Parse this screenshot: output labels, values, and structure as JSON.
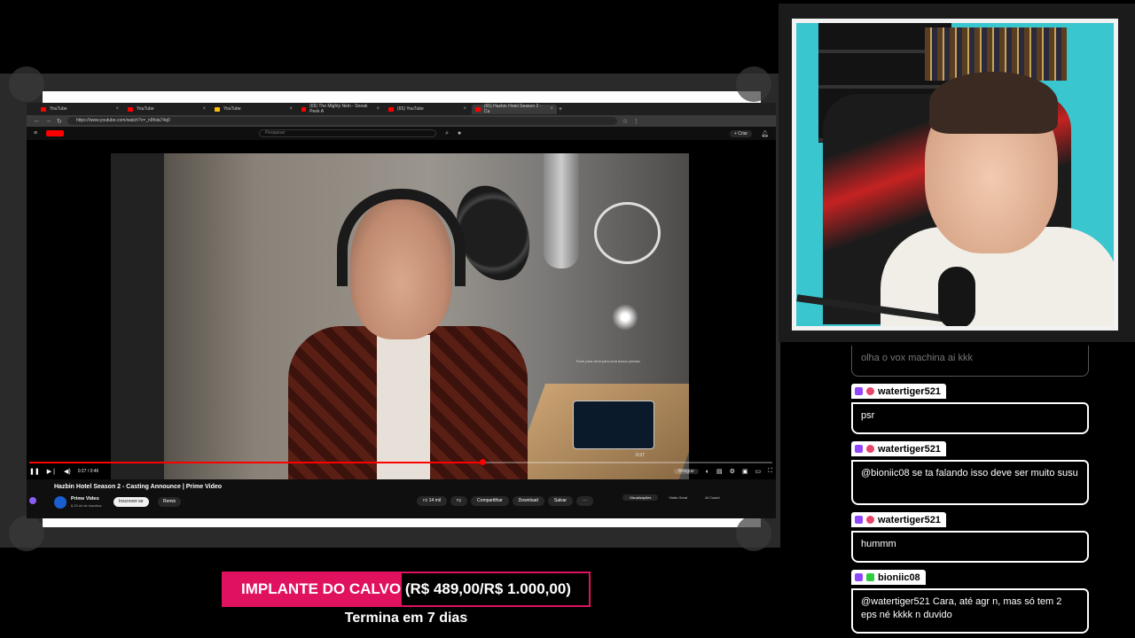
{
  "browser": {
    "tabs": [
      {
        "label": "YouTube",
        "active": false
      },
      {
        "label": "YouTube",
        "active": false
      },
      {
        "label": "YouTube",
        "active": false
      },
      {
        "label": "(65) The Mighty Nein - Sneak Peek A",
        "active": false
      },
      {
        "label": "(65) YouTube",
        "active": false
      },
      {
        "label": "(65) Hazbin Hotel Season 2 - Ca",
        "active": true
      }
    ],
    "url": "https://www.youtube.com/watch?v=_n9fola74q0",
    "search_placeholder": "Pesquisar",
    "create_label": "+ Criar"
  },
  "player": {
    "hover_hint": "Puxe para cima para uma busca precisa",
    "hover_time": "0:37",
    "current_time": "0:27 / 0:46",
    "progress_fraction": 0.61,
    "bilingual_label": "Bilingue"
  },
  "video": {
    "title": "Hazbin Hotel Season 2 - Casting Announce | Prime Video",
    "channel": "Prime Video",
    "subscribers": "6,23 mi de inscritos",
    "subscribe_label": "Inscrever-se",
    "remix_label": "Remix",
    "likes": "14 mil",
    "share_label": "Compartilhar",
    "download_label": "Download",
    "save_label": "Salvar",
    "side_tabs": [
      "Visualizações",
      "Visão Geral",
      "AI Coach"
    ]
  },
  "chat": {
    "first_message": "olha o vox machina ai kkk",
    "messages": [
      {
        "user": "watertiger521",
        "text": "psr"
      },
      {
        "user": "watertiger521",
        "text": "@bioniic08 se ta falando isso deve ser muito susu"
      },
      {
        "user": "watertiger521",
        "text": "hummm"
      },
      {
        "user": "bioniic08",
        "text": "@watertiger521 Cara, até agr n, mas só tem 2 eps né kkkk n duvido"
      }
    ]
  },
  "goal": {
    "text": "IMPLANTE DO CALVO (R$ 489,00/R$ 1.000,00)",
    "current": 489,
    "target": 1000,
    "subtitle": "Termina em 7 dias",
    "color": "#e0115f"
  }
}
